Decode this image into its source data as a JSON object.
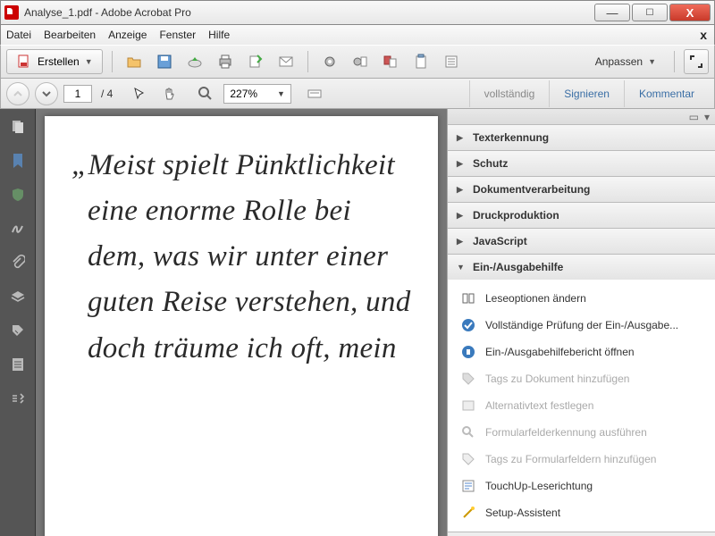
{
  "window": {
    "title": "Analyse_1.pdf - Adobe Acrobat Pro",
    "min": "—",
    "max": "☐",
    "close": "X"
  },
  "menu": {
    "items": [
      "Datei",
      "Bearbeiten",
      "Anzeige",
      "Fenster",
      "Hilfe"
    ],
    "close_x": "x"
  },
  "toolbar": {
    "create": "Erstellen",
    "anpassen": "Anpassen"
  },
  "nav": {
    "page_current": "1",
    "page_total": "/ 4",
    "zoom": "227%"
  },
  "modes": {
    "vollstaendig": "vollständig",
    "signieren": "Signieren",
    "kommentar": "Kommentar"
  },
  "document": {
    "text": "„Meist spielt Pünktlichkeit eine enorme Rolle bei dem, was wir unter einer guten Reise verstehen, und doch träume ich oft, mein"
  },
  "panel": {
    "sections": [
      {
        "label": "Texterkennung",
        "open": false
      },
      {
        "label": "Schutz",
        "open": false
      },
      {
        "label": "Dokumentverarbeitung",
        "open": false
      },
      {
        "label": "Druckproduktion",
        "open": false
      },
      {
        "label": "JavaScript",
        "open": false
      },
      {
        "label": "Ein-/Ausgabehilfe",
        "open": true
      }
    ],
    "tools": [
      {
        "label": "Leseoptionen ändern",
        "enabled": true
      },
      {
        "label": "Vollständige Prüfung der Ein-/Ausgabe...",
        "enabled": true
      },
      {
        "label": "Ein-/Ausgabehilfebericht öffnen",
        "enabled": true
      },
      {
        "label": "Tags zu Dokument hinzufügen",
        "enabled": false
      },
      {
        "label": "Alternativtext festlegen",
        "enabled": false
      },
      {
        "label": "Formularfelderkennung ausführen",
        "enabled": false
      },
      {
        "label": "Tags zu Formularfeldern hinzufügen",
        "enabled": false
      },
      {
        "label": "TouchUp-Leserichtung",
        "enabled": true
      },
      {
        "label": "Setup-Assistent",
        "enabled": true
      }
    ]
  }
}
